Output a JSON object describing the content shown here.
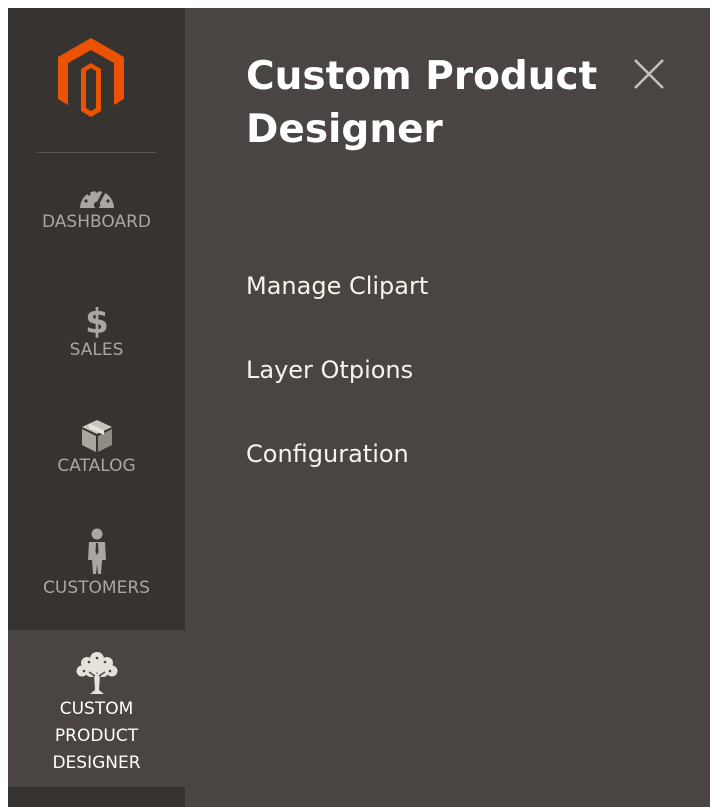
{
  "sidebar": {
    "logo_icon": "magento-logo-icon",
    "items": [
      {
        "label": "DASHBOARD",
        "icon": "dashboard-gauge-icon"
      },
      {
        "label": "SALES",
        "icon": "dollar-icon"
      },
      {
        "label": "CATALOG",
        "icon": "box-icon"
      },
      {
        "label": "CUSTOMERS",
        "icon": "person-icon"
      },
      {
        "label_lines": [
          "CUSTOM",
          "PRODUCT",
          "DESIGNER"
        ],
        "icon": "tree-icon",
        "active": true
      }
    ]
  },
  "panel": {
    "title": "Custom Product Designer",
    "close_icon": "close-icon",
    "links": [
      "Manage Clipart",
      "Layer Otpions",
      "Configuration"
    ]
  },
  "colors": {
    "sidebar_bg": "#373330",
    "panel_bg": "#4a4542",
    "logo_orange": "#eb5202",
    "sidebar_text": "#aaa6a0",
    "active_text": "#ffffff"
  }
}
